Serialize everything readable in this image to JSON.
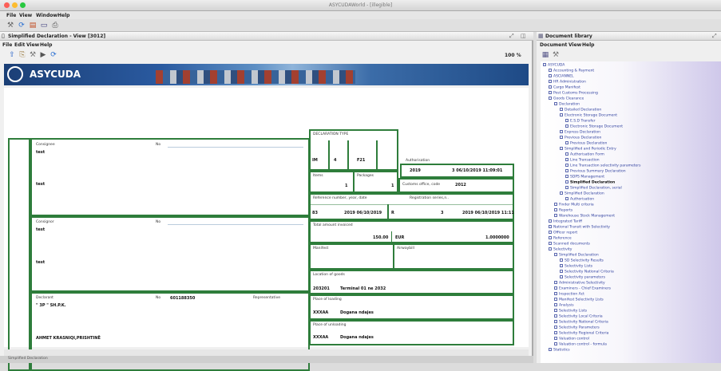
{
  "window": {
    "title": "ASYCUDAWorld - [illegible]",
    "menu": [
      "File",
      "View",
      "Window",
      "Help"
    ]
  },
  "left": {
    "title": "Simplified Declaration - View [3012]",
    "menu": [
      "File",
      "Edit",
      "View",
      "Help"
    ],
    "zoom": "100 %",
    "banner": "ASYCUDA"
  },
  "form": {
    "consignee": {
      "label": "Consignee",
      "no_label": "No",
      "line1": "test",
      "line2": "test"
    },
    "consignor": {
      "label": "Consignor",
      "no_label": "No",
      "line1": "test",
      "line2": "test"
    },
    "declarant": {
      "label": "Declarant",
      "no_label": "No",
      "no_value": "601188350",
      "rep_label": "Representative",
      "line1": "\" 3P \" SH.P.K.",
      "line2": "AHMET KRASNIQI,PRISHTINË"
    },
    "decl_type": {
      "label": "DECLARATION TYPE",
      "v1": "IM",
      "v2": "4",
      "v3": "F21"
    },
    "authorisation": {
      "label": "Authorisation",
      "year": "2019",
      "ref": "3 06/10/2019 11:09:01"
    },
    "items": {
      "label": "Items",
      "value": "1"
    },
    "packages": {
      "label": "Packages",
      "value": "1"
    },
    "customs_office": {
      "label": "Customs office, code",
      "value": "2012"
    },
    "reference": {
      "label": "Reference number, year, date",
      "v1": "83",
      "v2": "2019 06/10/2019",
      "v3": "R"
    },
    "registration": {
      "label": "Registration series,n..",
      "v1": "3",
      "v2": "2019 06/10/2019 11:11"
    },
    "total": {
      "label": "Total amount invoiced",
      "amount": "150.00",
      "currency": "EUR",
      "rate": "1.0000000"
    },
    "manifest": {
      "label": "Manifest"
    },
    "airwaybill": {
      "label": "Airwaybill"
    },
    "location": {
      "label": "Location of goods",
      "code": "203201",
      "desc": "Terminal 01 ne 2032"
    },
    "loading": {
      "label": "Place of loading",
      "code": "XXXAA",
      "desc": "Dogana ndajes"
    },
    "unloading": {
      "label": "Place of unloading",
      "code": "XXXAA",
      "desc": "Dogana ndajes"
    }
  },
  "right": {
    "title": "Document library",
    "menu": [
      "Document",
      "View",
      "Help"
    ],
    "tree": [
      {
        "t": "ASYCUDA",
        "d": 0
      },
      {
        "t": "Accounting & Payment",
        "d": 1
      },
      {
        "t": "ASCIANNEL",
        "d": 1
      },
      {
        "t": "HR Administration",
        "d": 1
      },
      {
        "t": "Cargo Manifest",
        "d": 1
      },
      {
        "t": "Post Customs Processing",
        "d": 1
      },
      {
        "t": "Goods Clearance",
        "d": 1
      },
      {
        "t": "Declaration",
        "d": 2
      },
      {
        "t": "Detailed Declaration",
        "d": 3
      },
      {
        "t": "Electronic Storage Document",
        "d": 3
      },
      {
        "t": "E.S.D Transfer",
        "d": 4
      },
      {
        "t": "Electronic Storage Document",
        "d": 4
      },
      {
        "t": "Express Declaration",
        "d": 3
      },
      {
        "t": "Previous Declaration",
        "d": 3
      },
      {
        "t": "Previous Declaration",
        "d": 4
      },
      {
        "t": "Simplified and Periodic Entry",
        "d": 3
      },
      {
        "t": "Authorisation Form",
        "d": 4
      },
      {
        "t": "Line Transaction",
        "d": 4
      },
      {
        "t": "Line Transaction selectivity parameters",
        "d": 4
      },
      {
        "t": "Previous Summary Declaration",
        "d": 4
      },
      {
        "t": "SDPS Management",
        "d": 4
      },
      {
        "t": "Simplified Declaration",
        "d": 4,
        "sel": true
      },
      {
        "t": "Simplified Declaration, serial",
        "d": 4
      },
      {
        "t": "Simplified Declaration",
        "d": 3
      },
      {
        "t": "Authorisation",
        "d": 4
      },
      {
        "t": "Finder Multi criteria",
        "d": 2
      },
      {
        "t": "Reports",
        "d": 2
      },
      {
        "t": "Warehouse Stock Management",
        "d": 2
      },
      {
        "t": "Integrated Tariff",
        "d": 1
      },
      {
        "t": "National Transit with Selectivity",
        "d": 1
      },
      {
        "t": "Officer report",
        "d": 1
      },
      {
        "t": "Reference",
        "d": 1
      },
      {
        "t": "Scanned documents",
        "d": 1
      },
      {
        "t": "Selectivity",
        "d": 1
      },
      {
        "t": "Simplified Declaration",
        "d": 2
      },
      {
        "t": "SD Selectivity Results",
        "d": 3
      },
      {
        "t": "Selectivity Lists",
        "d": 3
      },
      {
        "t": "Selectivity National Criteria",
        "d": 3
      },
      {
        "t": "Selectivity parameters",
        "d": 3
      },
      {
        "t": "Administrative Selectivity",
        "d": 2
      },
      {
        "t": "Examiners - Chief Examiners",
        "d": 2
      },
      {
        "t": "Inspection Act",
        "d": 2
      },
      {
        "t": "Manifest Selectivity Lists",
        "d": 2
      },
      {
        "t": "Analysis",
        "d": 2
      },
      {
        "t": "Selectivity Lists",
        "d": 2
      },
      {
        "t": "Selectivity Local Criteria",
        "d": 2
      },
      {
        "t": "Selectivity National Criteria",
        "d": 2
      },
      {
        "t": "Selectivity Parameters",
        "d": 2
      },
      {
        "t": "Selectivity Regional Criteria",
        "d": 2
      },
      {
        "t": "Valuation control",
        "d": 2
      },
      {
        "t": "Valuation control - formula",
        "d": 2
      },
      {
        "t": "Statistics",
        "d": 1
      }
    ]
  },
  "status": {
    "text": "Simplified Declaration"
  }
}
